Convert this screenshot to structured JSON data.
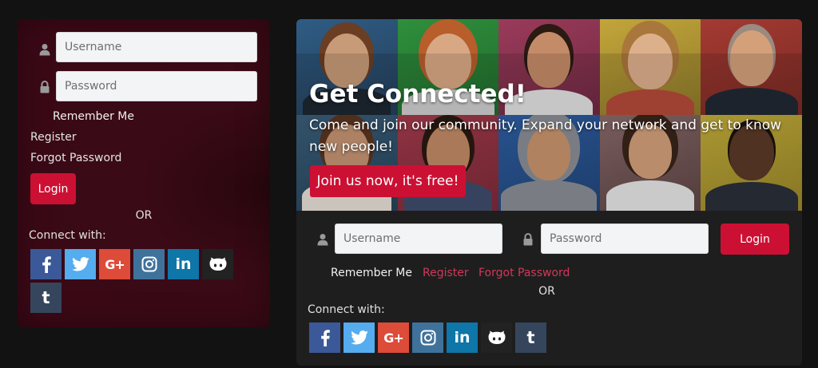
{
  "login_widget": {
    "username": {
      "placeholder": "Username",
      "icon": "user-icon"
    },
    "password": {
      "placeholder": "Password",
      "icon": "lock-icon"
    },
    "remember_label": "Remember Me",
    "register_link": "Register",
    "forgot_link": "Forgot Password",
    "login_button": "Login",
    "or_text": "OR",
    "connect_label": "Connect with:"
  },
  "signup_widget": {
    "hero_title": "Get Connected!",
    "hero_subtitle": "Come and join our community. Expand your network and get to know new people!",
    "join_button": "Join us now, it's free!",
    "username": {
      "placeholder": "Username",
      "icon": "user-icon"
    },
    "password": {
      "placeholder": "Password",
      "icon": "lock-icon"
    },
    "login_button": "Login",
    "remember_label": "Remember Me",
    "register_link": "Register",
    "forgot_link": "Forgot Password",
    "or_text": "OR",
    "connect_label": "Connect with:"
  },
  "social": [
    {
      "name": "facebook",
      "icon": "facebook-icon",
      "color": "#3b5998"
    },
    {
      "name": "twitter",
      "icon": "twitter-icon",
      "color": "#55acee"
    },
    {
      "name": "google-plus",
      "icon": "google-plus-icon",
      "color": "#dd4b39"
    },
    {
      "name": "instagram",
      "icon": "instagram-icon",
      "color": "#3f729b"
    },
    {
      "name": "linkedin",
      "icon": "linkedin-icon",
      "color": "#0e76a8"
    },
    {
      "name": "github",
      "icon": "github-icon",
      "color": "#222222"
    },
    {
      "name": "tumblr",
      "icon": "tumblr-icon",
      "color": "#35465c"
    }
  ],
  "colors": {
    "accent": "#cc1033",
    "link_accent": "#d2375a",
    "page_bg": "#121212",
    "panel_bg": "#1e1e1e",
    "left_panel_bg": "#3b0816"
  }
}
